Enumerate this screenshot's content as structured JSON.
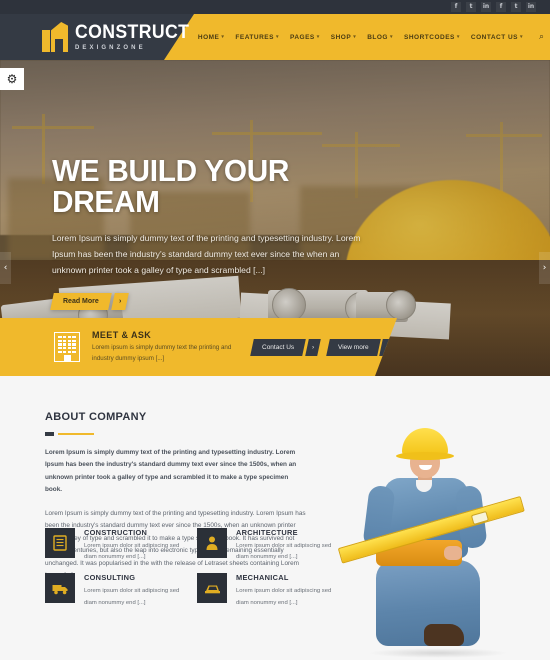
{
  "topbar": {
    "social": [
      {
        "name": "facebook-icon",
        "glyph": "f"
      },
      {
        "name": "twitter-icon",
        "glyph": "t"
      },
      {
        "name": "linkedin-icon",
        "glyph": "in"
      },
      {
        "name": "facebook-icon",
        "glyph": "f"
      },
      {
        "name": "twitter-icon",
        "glyph": "t"
      },
      {
        "name": "linkedin-icon",
        "glyph": "in"
      }
    ]
  },
  "header": {
    "logo_title": "CONSTRUCT",
    "logo_sub": "DEXIGNZONE",
    "nav": [
      {
        "label": "HOME",
        "caret": "▾"
      },
      {
        "label": "FEATURES",
        "caret": "▾"
      },
      {
        "label": "PAGES",
        "caret": "▾"
      },
      {
        "label": "SHOP",
        "caret": "▾"
      },
      {
        "label": "BLOG",
        "caret": "▾"
      },
      {
        "label": "SHORTCODES",
        "caret": "▾"
      },
      {
        "label": "CONTACT US",
        "caret": "▾"
      }
    ],
    "search_icon": "⌕"
  },
  "hero": {
    "title": "WE BUILD YOUR DREAM",
    "desc": "Lorem Ipsum is simply dummy text of the printing and typesetting industry. Lorem Ipsum has been the industry's standard dummy text ever since the when an unknown printer took a galley of type and scrambled [...]",
    "button_label": "Read More",
    "button_arrow": "›",
    "prev_arrow": "‹",
    "next_arrow": "›",
    "settings_icon": "⚙"
  },
  "meet": {
    "title": "MEET & ASK",
    "desc": "Lorem ipsum is simply dummy text the printing and industry dummy ipsum [...]",
    "buttons": [
      {
        "label": "Contact Us",
        "arrow": "›"
      },
      {
        "label": "View more",
        "arrow": "›"
      }
    ]
  },
  "about": {
    "title": "ABOUT COMPANY",
    "paragraph1": "Lorem Ipsum is simply dummy text of the printing and typesetting industry. Lorem Ipsum has been the industry's standard dummy text ever since the 1500s, when an unknown printer took a galley of type and scrambled it to make a type specimen book.",
    "paragraph2": "Lorem Ipsum is simply dummy text of the printing and typesetting industry. Lorem Ipsum has been the industry's standard dummy text ever since the 1500s, when an unknown printer took a galley of type and scrambled it to make a type specimen book. It has survived not only five centuries, but also the leap into electronic typesetting, remaining essentially unchanged. It was popularised in the with the release of Letraset sheets containing Lorem Ipsum [...]",
    "services": [
      {
        "title": "CONSTRUCTION",
        "desc": "Lorem ipsum dolor sit adipiscing sed diam nonummy end [...]",
        "icon": "building-icon"
      },
      {
        "title": "ARCHITECTURE",
        "desc": "Lorem ipsum dolor sit adipiscing sed diam nonummy end [...]",
        "icon": "person-icon"
      },
      {
        "title": "CONSULTING",
        "desc": "Lorem ipsum dolor sit adipiscing sed diam nonummy end [...]",
        "icon": "truck-icon"
      },
      {
        "title": "MECHANICAL",
        "desc": "Lorem ipsum dolor sit adipiscing sed diam nonummy end [...]",
        "icon": "machine-icon"
      }
    ]
  },
  "colors": {
    "accent": "#f0b92c",
    "dark": "#343a44",
    "tile": "#2b3038",
    "section_bg": "#f6f6f6"
  }
}
